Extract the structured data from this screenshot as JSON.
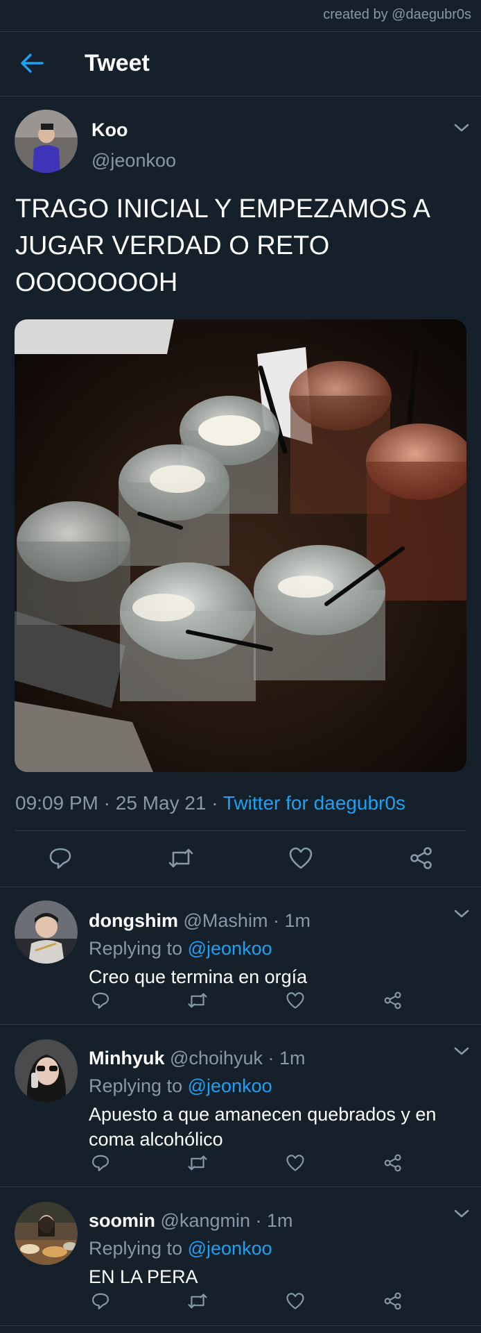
{
  "credit": "created by @daegubr0s",
  "header": {
    "title": "Tweet",
    "back_icon": "arrow-left-icon"
  },
  "tweet": {
    "author_name": "Koo",
    "author_handle": "@jeonkoo",
    "text": "TRAGO INICIAL Y EMPEZAMOS A JUGAR VERDAD O RETO OOOOOOOH",
    "time": "09:09 PM",
    "date": "25 May 21",
    "separator": " · ",
    "source": "Twitter for daegubr0s"
  },
  "actions": [
    "reply-icon",
    "retweet-icon",
    "like-icon",
    "share-icon"
  ],
  "replies": [
    {
      "name": "dongshim",
      "handle": "@Mashim",
      "time": "· 1m",
      "replying_prefix": "Replying to",
      "replying_to": "@jeonkoo",
      "text": "Creo que termina en orgía"
    },
    {
      "name": "Minhyuk",
      "handle": "@choihyuk",
      "time": "· 1m",
      "replying_prefix": "Replying to",
      "replying_to": "@jeonkoo",
      "text": "Apuesto a que amanecen quebrados y en coma alcohólico"
    },
    {
      "name": "soomin",
      "handle": "@kangmin",
      "time": "· 1m",
      "replying_prefix": "Replying to",
      "replying_to": "@jeonkoo",
      "text": "EN LA PERA"
    }
  ],
  "colors": {
    "background": "#15202b",
    "accent": "#1da1f2",
    "muted": "#8899a6",
    "divider": "#2f3d4a"
  }
}
